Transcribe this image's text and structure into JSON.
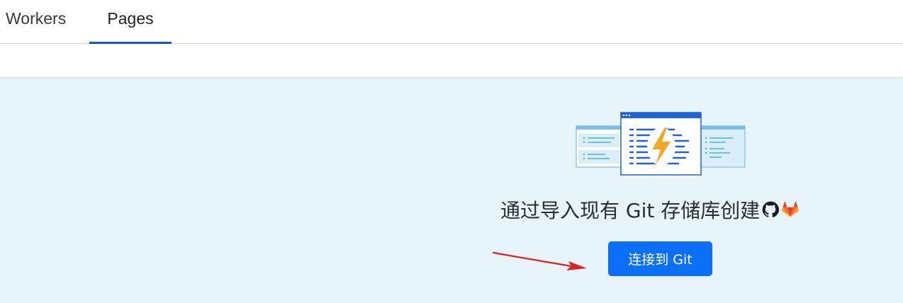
{
  "tabs": {
    "workers_label": "Workers",
    "pages_label": "Pages",
    "active": "Pages"
  },
  "main": {
    "headline": "通过导入现有 Git 存储库创建",
    "connect_button_label": "连接到 Git"
  },
  "icons": {
    "illustration": "pages-lightning-illustration-icon",
    "github": "github-icon",
    "gitlab": "gitlab-icon",
    "annotation": "red-arrow-icon"
  },
  "colors": {
    "accent": "#0b6ff7",
    "tab_underline": "#0a5bd6",
    "panel_background": "#e7f5fa",
    "lightning": "#f6a623",
    "gitlab_orange": "#e2432a",
    "arrow_red": "#e02020"
  }
}
